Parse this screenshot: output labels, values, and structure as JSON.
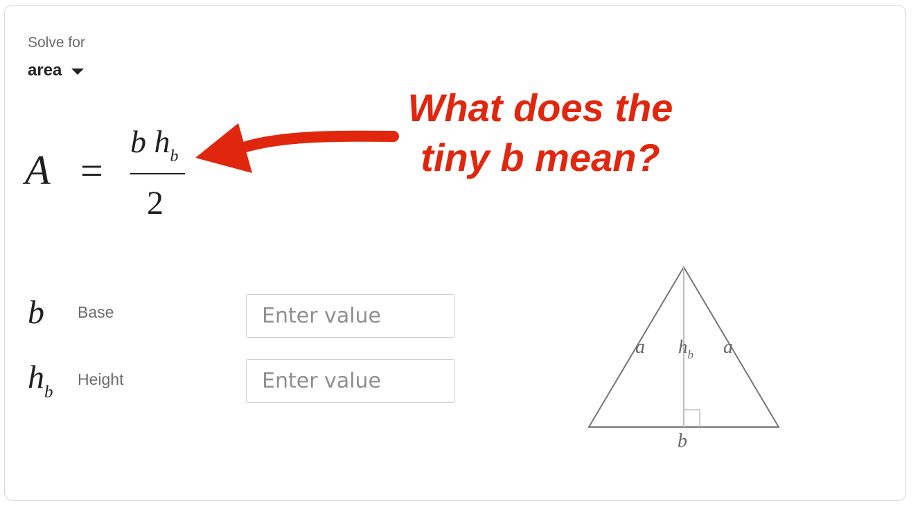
{
  "solve_for": {
    "label": "Solve for",
    "value": "area"
  },
  "formula": {
    "lhs": "A",
    "equals": "=",
    "numerator_base": "b h",
    "numerator_sub": "b",
    "denominator": "2"
  },
  "annotation": {
    "line1": "What does the",
    "line2": "tiny b mean?",
    "color": "#e1260e"
  },
  "variables": [
    {
      "symbol": "b",
      "subscript": "",
      "label": "Base",
      "placeholder": "Enter value",
      "value": ""
    },
    {
      "symbol": "h",
      "subscript": "b",
      "label": "Height",
      "placeholder": "Enter value",
      "value": ""
    }
  ],
  "diagram": {
    "side_left": "a",
    "side_right": "a",
    "height_label": "h",
    "height_sub": "b",
    "base_label": "b"
  }
}
